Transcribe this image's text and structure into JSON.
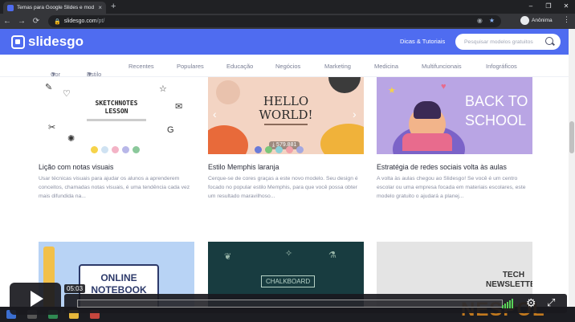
{
  "browser": {
    "tab_title": "Temas para Google Slides e mod",
    "tab_close": "×",
    "new_tab": "+",
    "url_host": "slidesgo.com",
    "url_path": "/pt/",
    "profile_label": "Anônima",
    "window_buttons": [
      "–",
      "❐",
      "✕"
    ],
    "nav": {
      "back": "←",
      "forward": "→",
      "reload": "⟳"
    },
    "menu": "⋮"
  },
  "site": {
    "logo_text": "slidesgo",
    "dicas_label": "Dicas & Tutoriais",
    "search_placeholder": "Pesquisar modelos gratuitos",
    "categories": [
      "Cor",
      "Estilo",
      "Recentes",
      "Populares",
      "Educação",
      "Negócios",
      "Marketing",
      "Medicina",
      "Multifuncionais",
      "Infográficos"
    ],
    "cards": [
      {
        "title": "Lição com notas visuais",
        "desc": "Usar técnicas visuais para ajudar os alunos a aprenderem conceitos, chamadas notas visuais, é uma tendência cada vez mais difundida na...",
        "thumb_title_1": "SKETCHNOTES",
        "thumb_title_2": "LESSON"
      },
      {
        "title": "Estilo Memphis laranja",
        "desc": "Cerque-se de cores graças a este novo modelo. Seu design é focado no popular estilo Memphis, para que você possa obter um resultado maravilhoso...",
        "thumb_title_1": "HELLO",
        "thumb_title_2": "WORLD!",
        "downloads": "579.881"
      },
      {
        "title": "Estratégia de redes sociais volta às aulas",
        "desc": "A volta às aulas chegou ao Slidesgo! Se você é um centro escolar ou uma empresa focada em materiais escolares, este modelo gratuito o ajudará a planej...",
        "thumb_title_1": "BACK TO",
        "thumb_title_2": "SCHOOL"
      }
    ],
    "row2": [
      {
        "thumb_title_1": "ONLINE",
        "thumb_title_2": "NOTEBOOK"
      },
      {
        "thumb_title_1": "CHALKBOARD"
      },
      {
        "thumb_title_1": "TECH",
        "thumb_title_2": "NEWSLETTER"
      }
    ]
  },
  "player": {
    "time": "05:03",
    "gear_icon": "gear-icon",
    "fullscreen_icon": "fullscreen-icon"
  },
  "watermark": "NESPOL",
  "colors": {
    "brand": "#4f6cf0",
    "volume": "#59d35a"
  }
}
